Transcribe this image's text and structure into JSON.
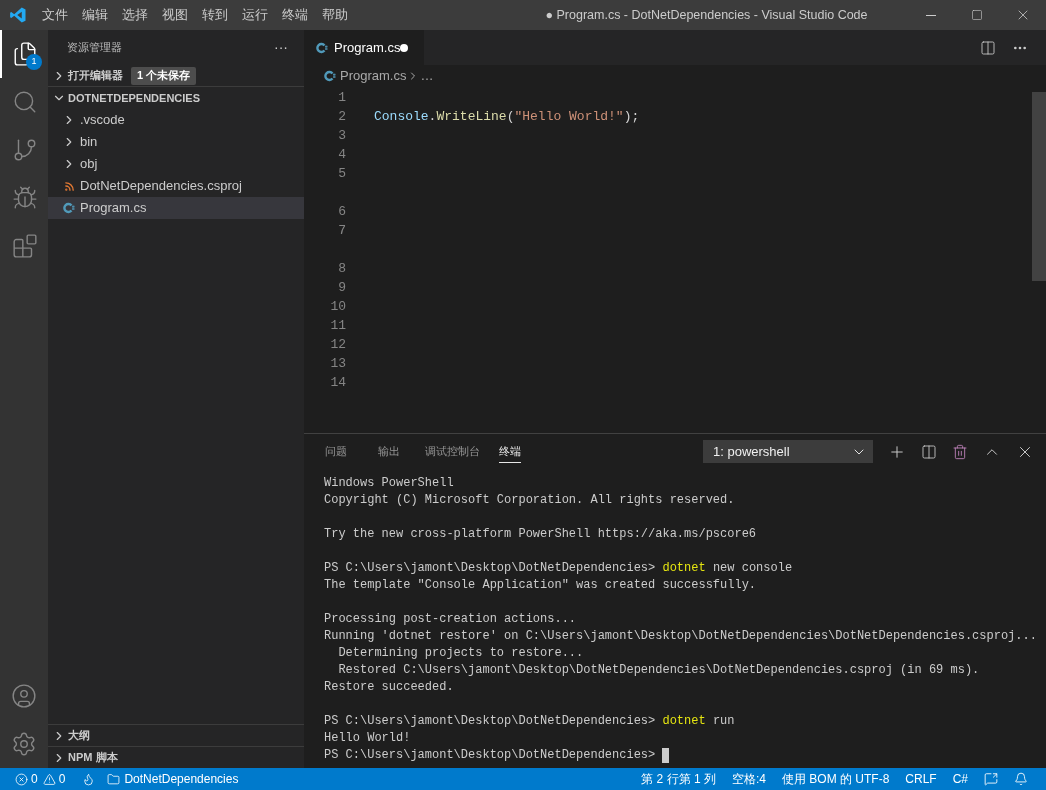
{
  "title_bar": {
    "menu": [
      "文件",
      "编辑",
      "选择",
      "视图",
      "转到",
      "运行",
      "终端",
      "帮助"
    ],
    "title": "● Program.cs - DotNetDependencies - Visual Studio Code"
  },
  "activity_bar": {
    "items": [
      {
        "kind": "explorer",
        "selected": true,
        "badge": "1"
      },
      {
        "kind": "search",
        "selected": false
      },
      {
        "kind": "source-control",
        "selected": false
      },
      {
        "kind": "run",
        "selected": false
      },
      {
        "kind": "extensions",
        "selected": false
      }
    ],
    "bottom": [
      {
        "kind": "account"
      },
      {
        "kind": "settings"
      }
    ]
  },
  "sidebar": {
    "title": "资源管理器",
    "more": "···",
    "open_editors": {
      "label": "打开编辑器",
      "badge": "1 个未保存",
      "expanded": false
    },
    "folder": {
      "label": "DOTNETDEPENDENCIES",
      "expanded": true,
      "items": [
        {
          "name": ".vscode",
          "kind": "folder",
          "expanded": false,
          "selected": false
        },
        {
          "name": "bin",
          "kind": "folder",
          "expanded": false,
          "selected": false
        },
        {
          "name": "obj",
          "kind": "folder",
          "expanded": false,
          "selected": false
        },
        {
          "name": "DotNetDependencies.csproj",
          "kind": "project",
          "selected": false
        },
        {
          "name": "Program.cs",
          "kind": "csharp",
          "selected": true
        }
      ]
    },
    "sections": [
      {
        "label": "大纲",
        "expanded": false
      },
      {
        "label": "NPM 脚本",
        "expanded": false
      }
    ]
  },
  "editor": {
    "tabs": [
      {
        "label": "Program.cs",
        "modified": true,
        "selected": true
      }
    ],
    "breadcrumb": [
      "Program.cs",
      "…"
    ],
    "lines": [
      {
        "kind": "line",
        "number": "1"
      },
      {
        "kind": "line",
        "number": "2",
        "tokens": [
          {
            "kind": "type",
            "text": "Console"
          },
          {
            "kind": "punct",
            "text": "."
          },
          {
            "kind": "method",
            "text": "WriteLine"
          },
          {
            "kind": "punct",
            "text": "("
          },
          {
            "kind": "string",
            "text": "\"Hello World!\""
          },
          {
            "kind": "punct",
            "text": ");"
          }
        ]
      },
      {
        "kind": "line",
        "number": "3"
      },
      {
        "kind": "line",
        "number": "4"
      },
      {
        "kind": "line",
        "number": "5"
      },
      {
        "kind": "gap"
      },
      {
        "kind": "line",
        "number": "6"
      },
      {
        "kind": "line",
        "number": "7"
      },
      {
        "kind": "gap"
      },
      {
        "kind": "line",
        "number": "8"
      },
      {
        "kind": "line",
        "number": "9"
      },
      {
        "kind": "line",
        "number": "10"
      },
      {
        "kind": "line",
        "number": "11"
      },
      {
        "kind": "line",
        "number": "12"
      },
      {
        "kind": "line",
        "number": "13"
      },
      {
        "kind": "line",
        "number": "14"
      }
    ]
  },
  "panel": {
    "tabs": [
      {
        "label": "问题",
        "selected": false
      },
      {
        "label": "输出",
        "selected": false
      },
      {
        "label": "调试控制台",
        "selected": false
      },
      {
        "label": "终端",
        "selected": true
      }
    ],
    "terminal_select": "1: powershell",
    "terminal": [
      {
        "kind": "line",
        "segments": [
          {
            "kind": "text",
            "text": "Windows PowerShell"
          }
        ]
      },
      {
        "kind": "line",
        "segments": [
          {
            "kind": "text",
            "text": "Copyright (C) Microsoft Corporation. All rights reserved."
          }
        ]
      },
      {
        "kind": "blank"
      },
      {
        "kind": "line",
        "segments": [
          {
            "kind": "text",
            "text": "Try the new cross-platform PowerShell https://aka.ms/pscore6"
          }
        ]
      },
      {
        "kind": "blank"
      },
      {
        "kind": "line",
        "segments": [
          {
            "kind": "text",
            "text": "PS C:\\Users\\jamont\\Desktop\\DotNetDependencies> "
          },
          {
            "kind": "command",
            "text": "dotnet"
          },
          {
            "kind": "text",
            "text": " new console"
          }
        ]
      },
      {
        "kind": "line",
        "segments": [
          {
            "kind": "text",
            "text": "The template \"Console Application\" was created successfully."
          }
        ]
      },
      {
        "kind": "blank"
      },
      {
        "kind": "line",
        "segments": [
          {
            "kind": "text",
            "text": "Processing post-creation actions..."
          }
        ]
      },
      {
        "kind": "line",
        "segments": [
          {
            "kind": "text",
            "text": "Running 'dotnet restore' on C:\\Users\\jamont\\Desktop\\DotNetDependencies\\DotNetDependencies.csproj..."
          }
        ]
      },
      {
        "kind": "line",
        "segments": [
          {
            "kind": "text",
            "text": "  Determining projects to restore..."
          }
        ]
      },
      {
        "kind": "line",
        "segments": [
          {
            "kind": "text",
            "text": "  Restored C:\\Users\\jamont\\Desktop\\DotNetDependencies\\DotNetDependencies.csproj (in 69 ms)."
          }
        ]
      },
      {
        "kind": "line",
        "segments": [
          {
            "kind": "text",
            "text": "Restore succeeded."
          }
        ]
      },
      {
        "kind": "blank"
      },
      {
        "kind": "line",
        "segments": [
          {
            "kind": "text",
            "text": "PS C:\\Users\\jamont\\Desktop\\DotNetDependencies> "
          },
          {
            "kind": "command",
            "text": "dotnet"
          },
          {
            "kind": "text",
            "text": " run"
          }
        ]
      },
      {
        "kind": "line",
        "segments": [
          {
            "kind": "text",
            "text": "Hello World!"
          }
        ]
      },
      {
        "kind": "line",
        "cursor": true,
        "segments": [
          {
            "kind": "text",
            "text": "PS C:\\Users\\jamont\\Desktop\\DotNetDependencies> "
          }
        ]
      }
    ]
  },
  "status_bar": {
    "errors": "0",
    "warnings": "0",
    "folder": "DotNetDependencies",
    "items": [
      "第 2 行第 1 列",
      "空格:4",
      "使用 BOM 的 UTF-8",
      "CRLF",
      "C#"
    ]
  }
}
